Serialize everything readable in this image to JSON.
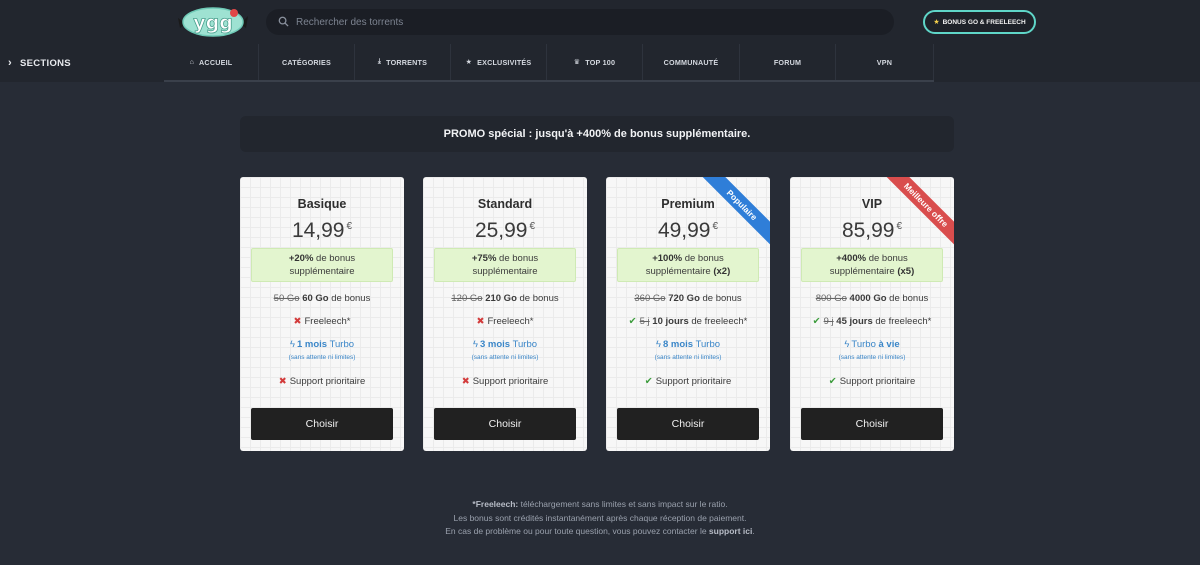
{
  "header": {
    "logo_text": "ygg",
    "search_placeholder": "Rechercher des torrents",
    "bonus_button": "BONUS GO & FREELEECH"
  },
  "nav": {
    "sections_label": "SECTIONS",
    "items": [
      {
        "label": "ACCUEIL",
        "icon": "home-icon"
      },
      {
        "label": "CATÉGORIES",
        "icon": ""
      },
      {
        "label": "TORRENTS",
        "icon": "download-icon"
      },
      {
        "label": "EXCLUSIVITÉS",
        "icon": "star-icon"
      },
      {
        "label": "TOP 100",
        "icon": "trophy-icon"
      },
      {
        "label": "COMMUNAUTÉ",
        "icon": ""
      },
      {
        "label": "FORUM",
        "icon": ""
      },
      {
        "label": "VPN",
        "icon": ""
      }
    ]
  },
  "promo": "PROMO spécial : jusqu'à +400% de bonus supplémentaire.",
  "currency": "€",
  "plans": [
    {
      "name": "Basique",
      "price": "14,99",
      "bonus_pct": "+20%",
      "bonus_text": " de bonus",
      "bonus_line2": "supplémentaire",
      "bonus_mult": "",
      "go_old": "50 Go",
      "go_new": "60 Go",
      "go_suffix": " de bonus",
      "freeleech_ok": false,
      "freeleech_old": "",
      "freeleech_new": "",
      "freeleech_text": "Freeleech*",
      "turbo_duration": "1 mois",
      "turbo_label": "Turbo",
      "turbo_sub": "(sans attente ni limites)",
      "support_ok": false,
      "support_text": "Support prioritaire",
      "button": "Choisir",
      "ribbon": ""
    },
    {
      "name": "Standard",
      "price": "25,99",
      "bonus_pct": "+75%",
      "bonus_text": " de bonus",
      "bonus_line2": "supplémentaire",
      "bonus_mult": "",
      "go_old": "120 Go",
      "go_new": "210 Go",
      "go_suffix": " de bonus",
      "freeleech_ok": false,
      "freeleech_old": "",
      "freeleech_new": "",
      "freeleech_text": "Freeleech*",
      "turbo_duration": "3 mois",
      "turbo_label": "Turbo",
      "turbo_sub": "(sans attente ni limites)",
      "support_ok": false,
      "support_text": "Support prioritaire",
      "button": "Choisir",
      "ribbon": ""
    },
    {
      "name": "Premium",
      "price": "49,99",
      "bonus_pct": "+100%",
      "bonus_text": " de bonus",
      "bonus_line2": "supplémentaire ",
      "bonus_mult": "(x2)",
      "go_old": "360 Go",
      "go_new": "720 Go",
      "go_suffix": " de bonus",
      "freeleech_ok": true,
      "freeleech_old": "5 j",
      "freeleech_new": "10 jours",
      "freeleech_text": " de freeleech*",
      "turbo_duration": "8 mois",
      "turbo_label": "Turbo",
      "turbo_sub": "(sans attente ni limites)",
      "support_ok": true,
      "support_text": "Support prioritaire",
      "button": "Choisir",
      "ribbon": "Populaire"
    },
    {
      "name": "VIP",
      "price": "85,99",
      "bonus_pct": "+400%",
      "bonus_text": " de bonus",
      "bonus_line2": "supplémentaire ",
      "bonus_mult": "(x5)",
      "go_old": "800 Go",
      "go_new": "4000 Go",
      "go_suffix": " de bonus",
      "freeleech_ok": true,
      "freeleech_old": "9 j",
      "freeleech_new": "45 jours",
      "freeleech_text": " de freeleech*",
      "turbo_duration": "à vie",
      "turbo_label": "Turbo ",
      "turbo_sub": "(sans attente ni limites)",
      "support_ok": true,
      "support_text": "Support prioritaire",
      "button": "Choisir",
      "ribbon": "Meilleure offre"
    }
  ],
  "footer": {
    "line1_bold": "*Freeleech:",
    "line1": " téléchargement sans limites et sans impact sur le ratio.",
    "line2": "Les bonus sont crédités instantanément après chaque réception de paiement.",
    "line3": "En cas de problème ou pour toute question, vous pouvez contacter le ",
    "line3_link": "support ici",
    "line3_end": "."
  },
  "colors": {
    "background": "#272c36",
    "accent_teal": "#5fd6c8",
    "turbo_blue": "#3a86c8",
    "ribbon_blue": "#2f7ed8",
    "ribbon_red": "#d94d4d",
    "bonus_green": "#e3f5cf"
  }
}
